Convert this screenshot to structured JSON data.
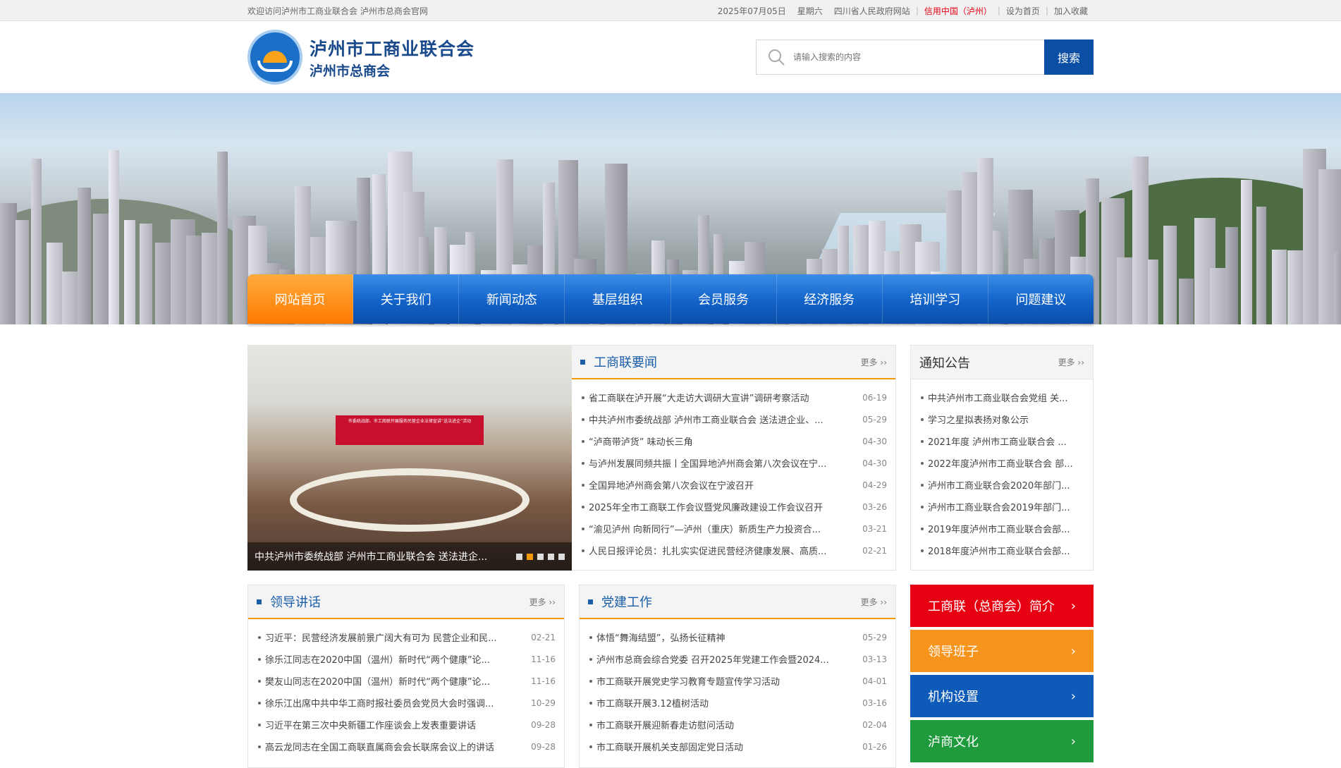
{
  "topbar": {
    "welcome": "欢迎访问泸州市工商业联合会 泸州市总商会官网",
    "date": "2025年07月05日",
    "weekday": "星期六",
    "links": [
      "四川省人民政府网站",
      "信用中国（泸州）",
      "设为首页",
      "加入收藏"
    ]
  },
  "header": {
    "title1": "泸州市工商业联合会",
    "title2": "泸州市总商会",
    "search_placeholder": "请输入搜索的内容",
    "search_button": "搜索"
  },
  "nav": [
    "网站首页",
    "关于我们",
    "新闻动态",
    "基层组织",
    "会员服务",
    "经济服务",
    "培训学习",
    "问题建议"
  ],
  "slider": {
    "caption": "中共泸州市委统战部 泸州市工商业联合会 送法进企...",
    "banner_text": "市委统战部、市工商联开展服务民营企业法律宣讲“送法进企”活动"
  },
  "news": {
    "title": "工商联要闻",
    "more": "更多",
    "items": [
      {
        "title": "省工商联在泸开展“大走访大调研大宣讲”调研考察活动",
        "date": "06-19"
      },
      {
        "title": "中共泸州市委统战部 泸州市工商业联合会 送法进企业、...",
        "date": "05-29"
      },
      {
        "title": "“泸商带泸货” 味动长三角",
        "date": "04-30"
      },
      {
        "title": "与泸州发展同频共振丨全国异地泸州商会第八次会议在宁...",
        "date": "04-30"
      },
      {
        "title": "全国异地泸州商会第八次会议在宁波召开",
        "date": "04-29"
      },
      {
        "title": "2025年全市工商联工作会议暨党风廉政建设工作会议召开",
        "date": "03-26"
      },
      {
        "title": "“渝见泸州 向新同行”—泸州（重庆）新质生产力投资合...",
        "date": "03-21"
      },
      {
        "title": "人民日报评论员：扎扎实实促进民营经济健康发展、高质...",
        "date": "02-21"
      }
    ]
  },
  "notice": {
    "title": "通知公告",
    "more": "更多",
    "items": [
      "中共泸州市工商业联合会党组 关...",
      "学习之星拟表扬对象公示",
      "2021年度 泸州市工商业联合会 ...",
      "2022年度泸州市工商业联合会 部...",
      "泸州市工商业联合会2020年部门...",
      "泸州市工商业联合会2019年部门...",
      "2019年度泸州市工商业联合会部...",
      "2018年度泸州市工商业联合会部..."
    ]
  },
  "speech": {
    "title": "领导讲话",
    "more": "更多",
    "items": [
      {
        "title": "习近平：民营经济发展前景广阔大有可为 民营企业和民...",
        "date": "02-21"
      },
      {
        "title": "徐乐江同志在2020中国（温州）新时代“两个健康”论...",
        "date": "11-16"
      },
      {
        "title": "樊友山同志在2020中国（温州）新时代“两个健康”论...",
        "date": "11-16"
      },
      {
        "title": "徐乐江出席中共中华工商时报社委员会党员大会时强调...",
        "date": "10-29"
      },
      {
        "title": "习近平在第三次中央新疆工作座谈会上发表重要讲话",
        "date": "09-28"
      },
      {
        "title": "高云龙同志在全国工商联直属商会会长联席会议上的讲话",
        "date": "09-28"
      }
    ]
  },
  "party": {
    "title": "党建工作",
    "more": "更多",
    "items": [
      {
        "title": "体悟“舞海结盟”，弘扬长征精神",
        "date": "05-29"
      },
      {
        "title": "泸州市总商会综合党委 召开2025年党建工作会暨2024...",
        "date": "03-13"
      },
      {
        "title": "市工商联开展党史学习教育专题宣传学习活动",
        "date": "04-01"
      },
      {
        "title": "市工商联开展3.12植树活动",
        "date": "03-16"
      },
      {
        "title": "市工商联开展迎新春走访慰问活动",
        "date": "02-04"
      },
      {
        "title": "市工商联开展机关支部固定党日活动",
        "date": "01-26"
      }
    ]
  },
  "quick": [
    {
      "label": "工商联（总商会）简介",
      "color": "#e60012"
    },
    {
      "label": "领导班子",
      "color": "#f7941d"
    },
    {
      "label": "机构设置",
      "color": "#0d5ab8"
    },
    {
      "label": "泸商文化",
      "color": "#1f9a3c"
    }
  ],
  "colors": {
    "accent": "#0a4fa3",
    "orange": "#f39800"
  }
}
